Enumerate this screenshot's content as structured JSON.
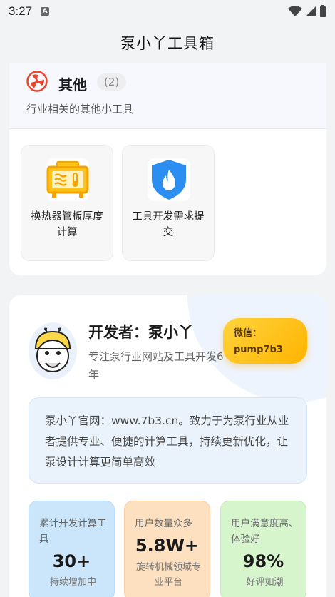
{
  "status": {
    "time": "3:27",
    "notification": "A"
  },
  "header": {
    "title": "泵小丫工具箱"
  },
  "category": {
    "title": "其他",
    "count": "(2)",
    "description": "行业相关的其他小工具",
    "icon": "fan-icon",
    "tools": [
      {
        "label": "换热器管板厚度计算",
        "icon": "heat-exchanger-icon"
      },
      {
        "label": "工具开发需求提交",
        "icon": "shield-flame-icon"
      }
    ]
  },
  "developer": {
    "name": "开发者：泵小丫",
    "description": "专注泵行业网站及工具开发6年",
    "wechat_label": "微信：",
    "wechat_id": "pump7b3",
    "intro": "泵小丫官网：www.7b3.cn。致力于为泵行业从业者提供专业、便捷的计算工具，持续更新优化，让泵设计计算更简单高效"
  },
  "stats": [
    {
      "label": "累计开发计算工具",
      "value": "30+",
      "sub": "持续增加中"
    },
    {
      "label": "用户数量众多",
      "value": "5.8W+",
      "sub": "旋转机械领域专业平台"
    },
    {
      "label": "用户满意度高、体验好",
      "value": "98%",
      "sub": "好评如潮"
    }
  ],
  "colors": {
    "accent": "#ffb400",
    "brand_red": "#e8452c",
    "shield_blue": "#2b8ef0"
  }
}
